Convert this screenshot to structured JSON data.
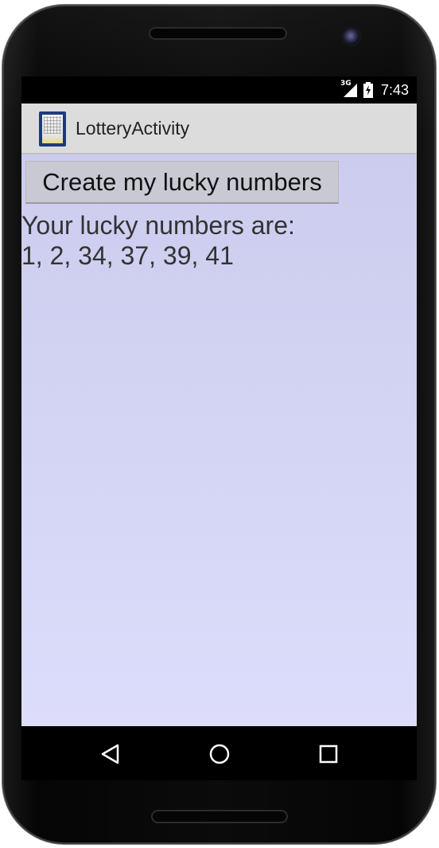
{
  "status_bar": {
    "network": "3G",
    "time": "7:43",
    "icons": [
      "signal-icon",
      "battery-charging-icon"
    ]
  },
  "action_bar": {
    "app_icon": "lottery-ticket-icon",
    "title": "LotteryActivity"
  },
  "main": {
    "button_label": "Create my lucky numbers",
    "result_heading": "Your lucky numbers are:",
    "result_numbers": "1, 2, 34, 37, 39, 41"
  },
  "nav_bar": {
    "buttons": [
      "back-icon",
      "home-icon",
      "recents-icon"
    ]
  },
  "colors": {
    "content_top": "#ccccee",
    "content_bottom": "#dcdcfb",
    "action_bar": "#dcdcdc",
    "button": "#c9c9d4"
  }
}
